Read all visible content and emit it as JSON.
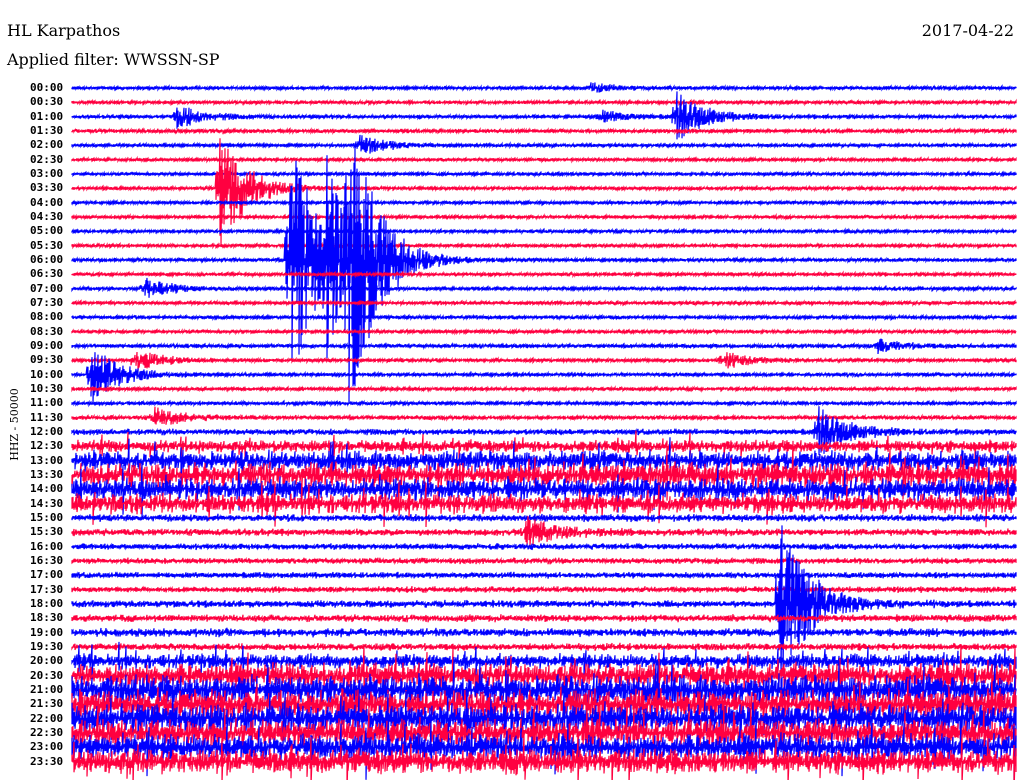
{
  "header": {
    "station": "HL Karpathos",
    "filter": "Applied filter: WWSSN-SP",
    "date": "2017-04-22"
  },
  "chart_data": {
    "type": "line",
    "title": "HL Karpathos 2017-04-22",
    "subtitle": "Applied filter: WWSSN-SP",
    "ylabel": "HHZ - 50000",
    "xlabel": "",
    "minutes_per_line": 30,
    "colors": [
      "#0000ff",
      "#ff0040"
    ],
    "lines": [
      "00:00",
      "00:30",
      "01:00",
      "01:30",
      "02:00",
      "02:30",
      "03:00",
      "03:30",
      "04:00",
      "04:30",
      "05:00",
      "05:30",
      "06:00",
      "06:30",
      "07:00",
      "07:30",
      "08:00",
      "08:30",
      "09:00",
      "09:30",
      "10:00",
      "10:30",
      "11:00",
      "11:30",
      "12:00",
      "12:30",
      "13:00",
      "13:30",
      "14:00",
      "14:30",
      "15:00",
      "15:30",
      "16:00",
      "16:30",
      "17:00",
      "17:30",
      "18:00",
      "18:30",
      "19:00",
      "19:30",
      "20:00",
      "20:30",
      "21:00",
      "21:30",
      "22:00",
      "22:30",
      "23:00",
      "23:30"
    ],
    "noise_level": [
      1.5,
      1.5,
      1.6,
      1.8,
      1.5,
      1.4,
      1.4,
      1.5,
      1.4,
      1.4,
      1.4,
      1.4,
      1.6,
      1.5,
      1.6,
      1.5,
      1.6,
      1.5,
      1.8,
      1.6,
      1.6,
      1.5,
      1.6,
      1.8,
      2.5,
      5,
      8,
      10,
      9,
      8,
      3,
      3,
      2.5,
      2.5,
      2.5,
      2.5,
      3,
      3,
      3.5,
      3,
      6,
      10,
      12,
      12,
      12,
      11,
      11,
      10
    ],
    "events": [
      {
        "line": 0,
        "minute": 16.4,
        "amp": 5
      },
      {
        "line": 2,
        "minute": 3.3,
        "amp": 12
      },
      {
        "line": 2,
        "minute": 16.8,
        "amp": 6
      },
      {
        "line": 2,
        "minute": 19.2,
        "amp": 25
      },
      {
        "line": 4,
        "minute": 9.1,
        "amp": 10
      },
      {
        "line": 7,
        "minute": 4.7,
        "amp": 60
      },
      {
        "line": 12,
        "minute": 6.9,
        "amp": 140
      },
      {
        "line": 12,
        "minute": 8.1,
        "amp": 70
      },
      {
        "line": 12,
        "minute": 8.8,
        "amp": 120
      },
      {
        "line": 14,
        "minute": 2.3,
        "amp": 10
      },
      {
        "line": 18,
        "minute": 25.6,
        "amp": 6
      },
      {
        "line": 19,
        "minute": 2.0,
        "amp": 10
      },
      {
        "line": 19,
        "minute": 20.7,
        "amp": 8
      },
      {
        "line": 20,
        "minute": 0.6,
        "amp": 30
      },
      {
        "line": 23,
        "minute": 2.6,
        "amp": 10
      },
      {
        "line": 24,
        "minute": 23.7,
        "amp": 25
      },
      {
        "line": 31,
        "minute": 14.4,
        "amp": 15
      },
      {
        "line": 36,
        "minute": 22.5,
        "amp": 90
      }
    ]
  }
}
